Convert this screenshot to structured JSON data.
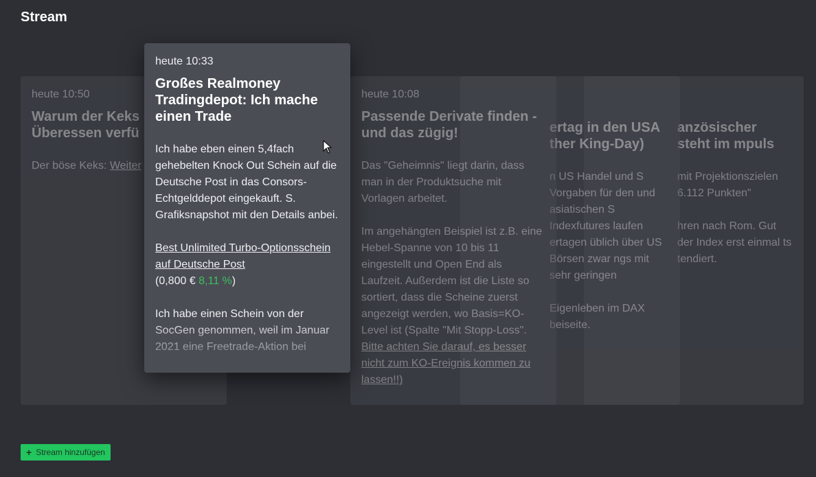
{
  "page": {
    "title": "Stream"
  },
  "cards": [
    {
      "time": "heute 10:50",
      "title": "Warum der Keks Überessen verfü",
      "body_prefix": "Der böse Keks: ",
      "body_link": "Weiter"
    },
    {
      "time": "heute 10:33",
      "title": "Großes Realmoney Tradingdepot: Ich mache einen Trade",
      "p1": "Ich habe eben einen 5,4fach gehebelten Knock Out Schein auf die Deutsche Post in das Consors-Echtgelddepot eingekauft. S. Grafiksnapshot mit den Details anbei.",
      "link": "Best Unlimited Turbo-Optionsschein auf Deutsche Post",
      "price_open": "(0,800 € ",
      "change": "8,11 %",
      "price_close": ")",
      "p3": "Ich habe einen Schein von der SocGen genommen, weil im Januar 2021 eine Freetrade-Aktion bei"
    },
    {
      "time": "heute 10:08",
      "title": "Passende Derivate finden - und das zügig!",
      "p1": "Das \"Geheimnis\" liegt darin, dass man in der Produktsuche mit Vorlagen arbeitet.",
      "p2": "Im angehängten Beispiel ist z.B. eine Hebel-Spanne von 10 bis 11 eingestellt und Open End als Laufzeit. Außerdem ist die Liste so sortiert, dass die Scheine zuerst angezeigt werden, wo Basis=KO-Level ist (Spalte \"Mit Stopp-Loss\". ",
      "p2_link": "Bitte achten Sie darauf, es besser nicht zum KO-Ereignis kommen zu lassen!!)"
    },
    {
      "title": "ertag in den USA ther King-Day)",
      "p1": "n US Handel und S Vorgaben für den und asiatischen S Indexfutures laufen ertagen üblich über US Börsen zwar ngs mit sehr geringen",
      "p2": "Eigenleben im DAX beiseite."
    },
    {
      "title": "anzösischer steht im mpuls",
      "p1": "mit Projektionszielen 6.112 Punkten\"",
      "p2": "hren nach Rom. Gut der Index erst einmal ts tendiert."
    }
  ],
  "add_button": {
    "label": "Stream hinzufügen",
    "icon": "plus-icon",
    "color": "#22c55e"
  },
  "colors": {
    "background": "#2d2f35",
    "card": "#4a4d54",
    "positive": "#3fbf5f"
  }
}
